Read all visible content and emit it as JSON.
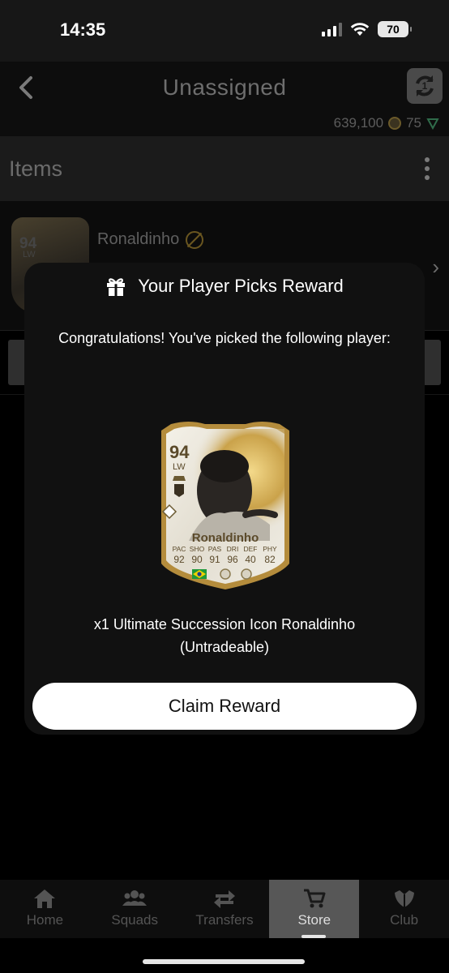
{
  "status": {
    "time": "14:35",
    "battery": "70"
  },
  "header": {
    "title": "Unassigned",
    "coins": "639,100",
    "points": "75"
  },
  "items_bar": {
    "title": "Items"
  },
  "list": {
    "player_name": "Ronaldinho",
    "card_rating": "94",
    "card_position": "LW"
  },
  "modal": {
    "title": "Your Player Picks Reward",
    "message": "Congratulations! You've picked the following player:",
    "reward_line1": "x1 Ultimate Succession Icon Ronaldinho",
    "reward_line2": "(Untradeable)",
    "claim_label": "Claim Reward"
  },
  "player_card": {
    "rating": "94",
    "position": "LW",
    "name": "Ronaldinho",
    "stat_labels": [
      "PAC",
      "SHO",
      "PAS",
      "DRI",
      "DEF",
      "PHY"
    ],
    "stat_values": [
      "92",
      "90",
      "91",
      "96",
      "40",
      "82"
    ],
    "colors": {
      "card_light": "#efece3",
      "card_gold": "#c9a44a",
      "text": "#5b4a2a"
    }
  },
  "nav": {
    "items": [
      {
        "label": "Home",
        "icon": "home-icon"
      },
      {
        "label": "Squads",
        "icon": "squads-icon"
      },
      {
        "label": "Transfers",
        "icon": "transfers-icon"
      },
      {
        "label": "Store",
        "icon": "cart-icon",
        "active": true
      },
      {
        "label": "Club",
        "icon": "club-icon"
      }
    ]
  }
}
